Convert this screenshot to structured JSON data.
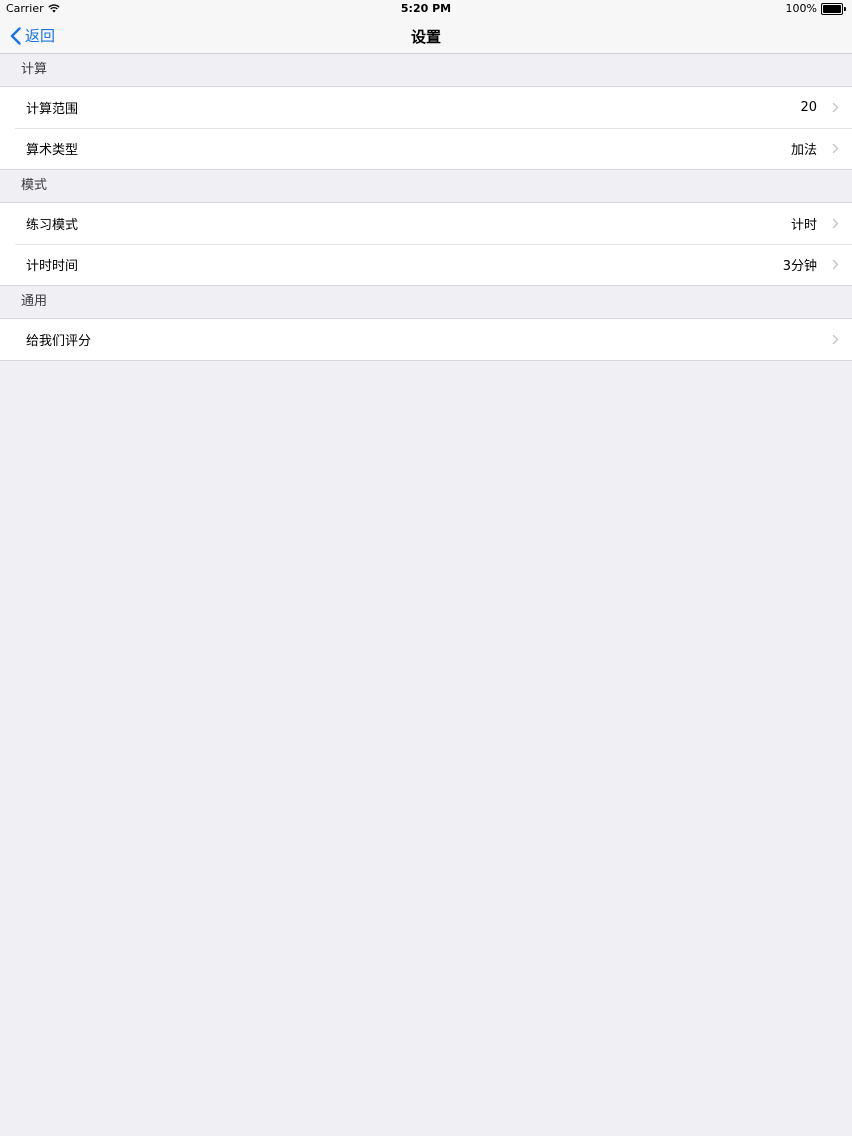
{
  "status_bar": {
    "carrier": "Carrier",
    "time": "5:20 PM",
    "battery": "100%"
  },
  "nav": {
    "back_label": "返回",
    "title": "设置"
  },
  "sections": [
    {
      "header": "计算",
      "rows": [
        {
          "label": "计算范围",
          "value": "20"
        },
        {
          "label": "算术类型",
          "value": "加法"
        }
      ]
    },
    {
      "header": "模式",
      "rows": [
        {
          "label": "练习模式",
          "value": "计时"
        },
        {
          "label": "计时时间",
          "value": "3分钟"
        }
      ]
    },
    {
      "header": "通用",
      "rows": [
        {
          "label": "给我们评分",
          "value": ""
        }
      ]
    }
  ],
  "icons": {
    "wifi": "wifi-icon",
    "battery": "battery-icon",
    "back": "chevron-left-icon",
    "disclosure": "chevron-right-icon"
  },
  "colors": {
    "accent": "#1a73e8",
    "background": "#efeff4",
    "bar": "#f7f7f7"
  }
}
